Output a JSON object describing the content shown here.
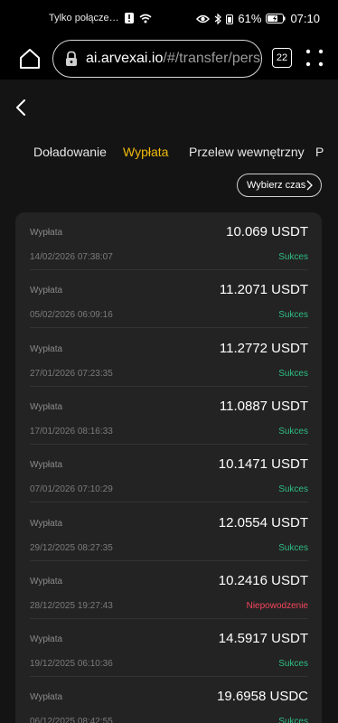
{
  "status_bar": {
    "network": "Tylko połącze…",
    "battery": "61%",
    "time": "07:10"
  },
  "browser": {
    "url_host": "ai.arvexai.io",
    "url_path": "/#/transfer/perso",
    "tabs_count": "22"
  },
  "tabs": [
    {
      "label": "Doładowanie",
      "active": false
    },
    {
      "label": "Wypłata",
      "active": true
    },
    {
      "label": "Przelew wewnętrzny",
      "active": false
    },
    {
      "label": "P",
      "active": false
    }
  ],
  "filter": {
    "label": "Wybierz czas"
  },
  "colors": {
    "accent": "#f0b90b",
    "success": "#2ebd85",
    "fail": "#f6465d"
  },
  "transactions": [
    {
      "type": "Wypłata",
      "amount": "10.069 USDT",
      "date": "14/02/2026 07:38:07",
      "status": "Sukces",
      "ok": true
    },
    {
      "type": "Wypłata",
      "amount": "11.2071 USDT",
      "date": "05/02/2026 06:09:16",
      "status": "Sukces",
      "ok": true
    },
    {
      "type": "Wypłata",
      "amount": "11.2772 USDT",
      "date": "27/01/2026 07:23:35",
      "status": "Sukces",
      "ok": true
    },
    {
      "type": "Wypłata",
      "amount": "11.0887 USDT",
      "date": "17/01/2026 08:16:33",
      "status": "Sukces",
      "ok": true
    },
    {
      "type": "Wypłata",
      "amount": "10.1471 USDT",
      "date": "07/01/2026 07:10:29",
      "status": "Sukces",
      "ok": true
    },
    {
      "type": "Wypłata",
      "amount": "12.0554 USDT",
      "date": "29/12/2025 08:27:35",
      "status": "Sukces",
      "ok": true
    },
    {
      "type": "Wypłata",
      "amount": "10.2416 USDT",
      "date": "28/12/2025 19:27:43",
      "status": "Niepowodzenie",
      "ok": false
    },
    {
      "type": "Wypłata",
      "amount": "14.5917 USDT",
      "date": "19/12/2025 06:10:36",
      "status": "Sukces",
      "ok": true
    },
    {
      "type": "Wypłata",
      "amount": "19.6958 USDC",
      "date": "06/12/2025 08:42:55",
      "status": "Sukces",
      "ok": true
    }
  ]
}
